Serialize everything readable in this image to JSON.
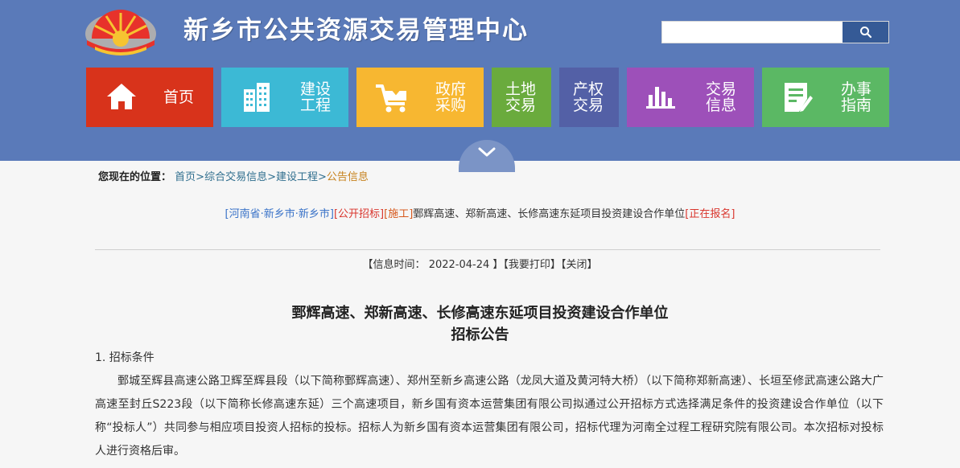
{
  "header": {
    "site_title": "新乡市公共资源交易管理中心",
    "search": {
      "placeholder": ""
    },
    "colors": {
      "background": "#5a7ab9",
      "search_button": "#355a96"
    }
  },
  "nav": {
    "tiles": [
      {
        "label": "首页",
        "icon": "home-icon",
        "color": "#d8331b"
      },
      {
        "label": "建设\n工程",
        "icon": "building-icon",
        "color": "#3cb9d5"
      },
      {
        "label": "政府\n采购",
        "icon": "cart-icon",
        "color": "#f7b731"
      },
      {
        "label": "土地\n交易",
        "icon": "",
        "color": "#6aab3d"
      },
      {
        "label": "产权\n交易",
        "icon": "",
        "color": "#5360a6"
      },
      {
        "label": "交易\n信息",
        "icon": "bar-chart-icon",
        "color": "#9d50b9"
      },
      {
        "label": "办事\n指南",
        "icon": "document-icon",
        "color": "#5bb864"
      }
    ]
  },
  "breadcrumb": {
    "prefix": "您现在的位置：",
    "items": [
      "首页",
      "综合交易信息",
      "建设工程",
      "公告信息"
    ],
    "separator": ">"
  },
  "article": {
    "region_tag": "[河南省·新乡市·新乡市]",
    "type_tag": "[公开招标]",
    "category_tag": "[施工]",
    "title_text": "鄄辉高速、郑新高速、长修高速东延项目投资建设合作单位",
    "status_tag": "[正在报名]",
    "meta": {
      "time_label": "【信息时间：",
      "time_value": "2022-04-24",
      "time_close": "】",
      "print": "【我要打印】",
      "close": "【关闭】"
    },
    "doc_title_line1": "鄄辉高速、郑新高速、长修高速东延项目投资建设合作单位",
    "doc_title_line2": "招标公告",
    "section1_heading": "1. 招标条件",
    "section1_body": "鄄城至辉县高速公路卫辉至辉县段（以下简称鄄辉高速）、郑州至新乡高速公路（龙凤大道及黄河特大桥）（以下简称郑新高速）、长垣至修武高速公路大广高速至封丘S223段（以下简称长修高速东延）三个高速项目，新乡国有资本运营集团有限公司拟通过公开招标方式选择满足条件的投资建设合作单位（以下称“投标人”）共同参与相应项目投资人招标的投标。招标人为新乡国有资本运营集团有限公司，招标代理为河南全过程工程研究院有限公司。本次招标对投标人进行资格后审。"
  }
}
